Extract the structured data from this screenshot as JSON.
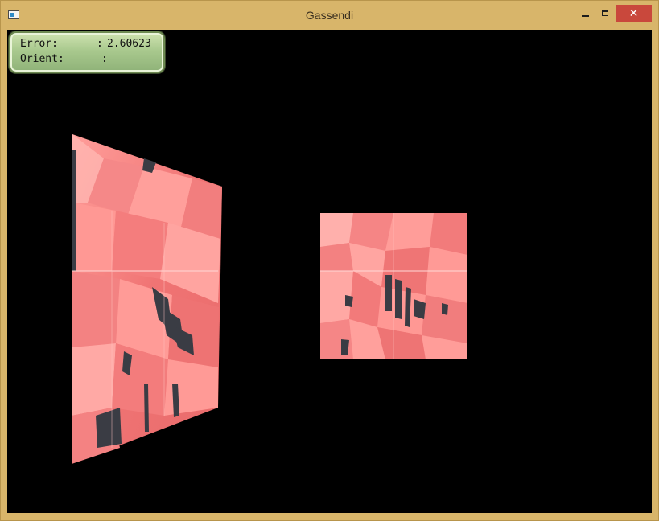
{
  "window": {
    "title": "Gassendi",
    "icon": "app-window-icon",
    "controls": {
      "minimize": "minimize-icon",
      "maximize": "maximize-icon",
      "close": "✕"
    }
  },
  "hud": {
    "error_label": "Error:",
    "error_colon": ":",
    "error_value": "2.60623",
    "orient_label": "Orient:",
    "orient_colon": ":",
    "orient_value": ""
  },
  "colors": {
    "surface": "#f27b7b",
    "surface_light": "#ffb1ad",
    "surface_shadow": "#3a3c44",
    "background": "#000000",
    "hud": "#a9c98e",
    "frame": "#d8b56a"
  }
}
